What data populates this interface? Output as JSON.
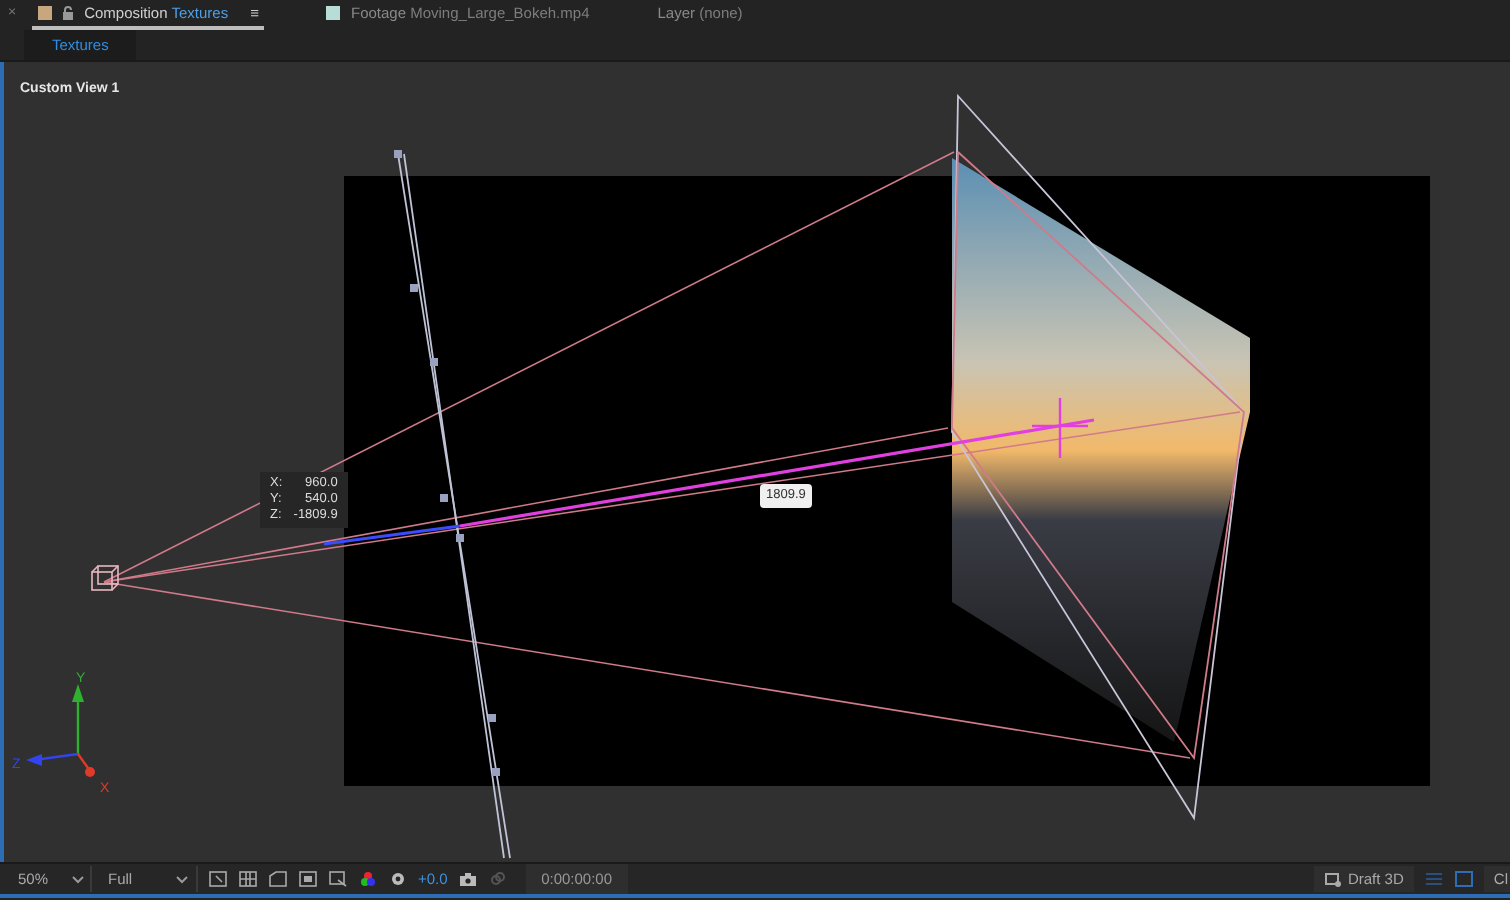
{
  "panel_tabs": [
    {
      "kind": "composition",
      "type_label": "Composition",
      "name": "Textures",
      "selected": true,
      "color": "#c8a77e"
    },
    {
      "kind": "footage",
      "type_label": "Footage",
      "name": "Moving_Large_Bokeh.mp4",
      "selected": false,
      "color": "#b8ddd6"
    },
    {
      "kind": "layer",
      "type_label": "Layer",
      "name": "(none)",
      "selected": false
    }
  ],
  "close_glyph": "×",
  "menu_glyph": "≡",
  "breadcrumb": [
    {
      "label": "Textures",
      "selected": true
    }
  ],
  "viewer": {
    "view_name": "Custom View 1",
    "position_readout": [
      {
        "axis": "X:",
        "value": "960.0"
      },
      {
        "axis": "Y:",
        "value": "540.0"
      },
      {
        "axis": "Z:",
        "value": "-1809.9"
      }
    ],
    "distance_label": "1809.9",
    "axis_labels": [
      "X",
      "Y",
      "Z"
    ]
  },
  "toolbar": {
    "zoom": "50%",
    "resolution": "Full",
    "exposure": "+0.0",
    "timecode": "0:00:00:00",
    "renderer": "Draft 3D",
    "cut_button": "Cl"
  }
}
